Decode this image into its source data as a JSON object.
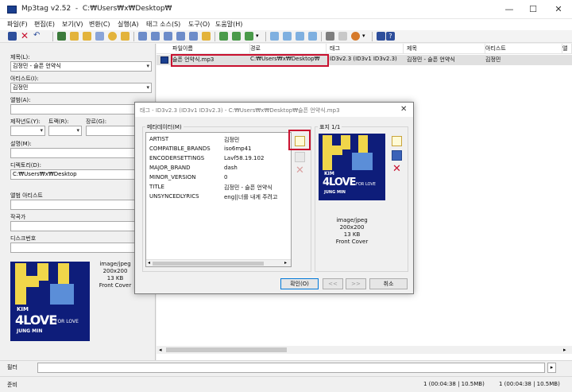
{
  "window": {
    "title": "Mp3tag v2.52  -  C:₩Users₩x₩Desktop₩",
    "minimize": "—",
    "maximize": "☐",
    "close": "✕"
  },
  "menu": [
    "파일(F)",
    "편집(E)",
    "보기(V)",
    "변환(C)",
    "실행(A)",
    "태그 소스(S)",
    "도구(O)",
    "도움말(H)"
  ],
  "left_panel": {
    "title_label": "제목(L):",
    "title_value": "김정민 - 슬픈 언약식",
    "artist_label": "아티스트(I):",
    "artist_value": "김정민",
    "album_label": "앨범(A):",
    "album_value": "",
    "year_label": "제작년도(Y):",
    "track_label": "트랙(R):",
    "genre_label": "장르(G):",
    "comment_label": "설명(M):",
    "comment_value": "",
    "directory_label": "디렉토리(D):",
    "directory_value": "C:₩Users₩x₩Desktop",
    "album_artist_label": "앨범 아티스트",
    "composer_label": "작곡가",
    "disc_label": "디스크번호",
    "cover_info": [
      "image/jpeg",
      "200x200",
      "13 KB",
      "Front Cover"
    ]
  },
  "cover_art": {
    "big_text": "KJ",
    "kim_text": "KIM",
    "love_text": "4LOVE",
    "name_text": "JUNG MIN",
    "for_love": "FOR LOVE"
  },
  "file_list": {
    "columns": [
      "파일이름",
      "경로",
      "태그",
      "제목",
      "아티스트",
      "앨"
    ],
    "rows": [
      {
        "filename": "슬픈 언약식.mp3",
        "path": "C:₩Users₩x₩Desktop₩",
        "tag": "ID3v2.3 (ID3v1 ID3v2.3)",
        "title": "김정민 - 슬픈 언약식",
        "artist": "김정민"
      }
    ]
  },
  "filter": {
    "label": "필터",
    "value": "",
    "go": "▸"
  },
  "status": {
    "left": "준비",
    "selected": "1 (00:04:38 | 10.5MB)",
    "total": "1 (00:04:38 | 10.5MB)"
  },
  "dialog": {
    "title": "태그 - ID3v2.3 (ID3v1 ID3v2.3) - C:₩Users₩x₩Desktop₩슬픈 언약식.mp3",
    "close": "✕",
    "metadata_label": "메타데이터(M)",
    "cover_label": "표지 1/1",
    "metadata": [
      {
        "key": "ARTIST",
        "value": "김정민"
      },
      {
        "key": "COMPATIBLE_BRANDS",
        "value": "iso6mp41"
      },
      {
        "key": "ENCODERSETTINGS",
        "value": "Lavf58.19.102"
      },
      {
        "key": "MAJOR_BRAND",
        "value": "dash"
      },
      {
        "key": "MINOR_VERSION",
        "value": "0"
      },
      {
        "key": "TITLE",
        "value": "김정민 - 슬픈 언약식"
      },
      {
        "key": "UNSYNCEDLYRICS",
        "value": "eng||너를 내게 주려고 "
      }
    ],
    "cover_info": [
      "image/jpeg",
      "200x200",
      "13 KB",
      "Front Cover"
    ],
    "ok": "확인(O)",
    "prev": "<<",
    "next": ">>",
    "cancel": "취소"
  },
  "colors": {
    "highlight": "#c8102e",
    "accent": "#0078d7",
    "cover_bg": "#0e1d7a",
    "cover_yellow": "#f0d64a",
    "cover_blue": "#5b8ed8"
  }
}
